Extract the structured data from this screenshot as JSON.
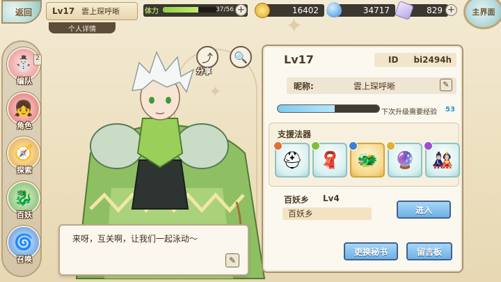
{
  "topbar": {
    "back_label": "返回",
    "level": "Lv17",
    "player_name": "雲上琛呼晰",
    "detail_tab": "个人详情",
    "stamina_label": "体力",
    "stamina_text": "37/56",
    "stamina_fraction": 0.66,
    "gold": "16402",
    "water": "34717",
    "crystal": "829",
    "main_label": "主界面"
  },
  "nav": [
    {
      "label": "编队",
      "icon": "snowman-icon",
      "badge": "2"
    },
    {
      "label": "角色",
      "icon": "girl-icon"
    },
    {
      "label": "探索",
      "icon": "compass-icon"
    },
    {
      "label": "百妖",
      "icon": "monster-icon"
    },
    {
      "label": "召唤",
      "icon": "swirl-icon"
    }
  ],
  "tools": {
    "share_label": "分享"
  },
  "dialog": {
    "text": "来呀，互关啊，让我们一起泳动～"
  },
  "profile": {
    "level": "Lv17",
    "id_label": "ID",
    "id_value": "bi2494h",
    "nick_label": "昵称:",
    "nick_value": "雲上琛呼晰",
    "exp_label": "下次升级需要经验",
    "exp_value": "53",
    "exp_fraction": 0.56,
    "support_title": "支援法器",
    "support_items": [
      {
        "icon": "helmet-icon",
        "gem": "#e07030",
        "gold": false
      },
      {
        "icon": "scarf-icon",
        "gem": "#7dbf3a",
        "gold": false
      },
      {
        "icon": "dragon-icon",
        "gem": "#3a7fd0",
        "gold": true
      },
      {
        "icon": "orb-icon",
        "gem": "#e0b030",
        "gold": false
      },
      {
        "icon": "doll-icon",
        "gem": "#9a4fd0",
        "gold": false
      }
    ],
    "guild_name": "百妖乡",
    "guild_level": "Lv4",
    "guild_field": "百妖乡",
    "join_button": "进入",
    "change_secretary_button": "更换秘书",
    "message_board_button": "留言板"
  }
}
